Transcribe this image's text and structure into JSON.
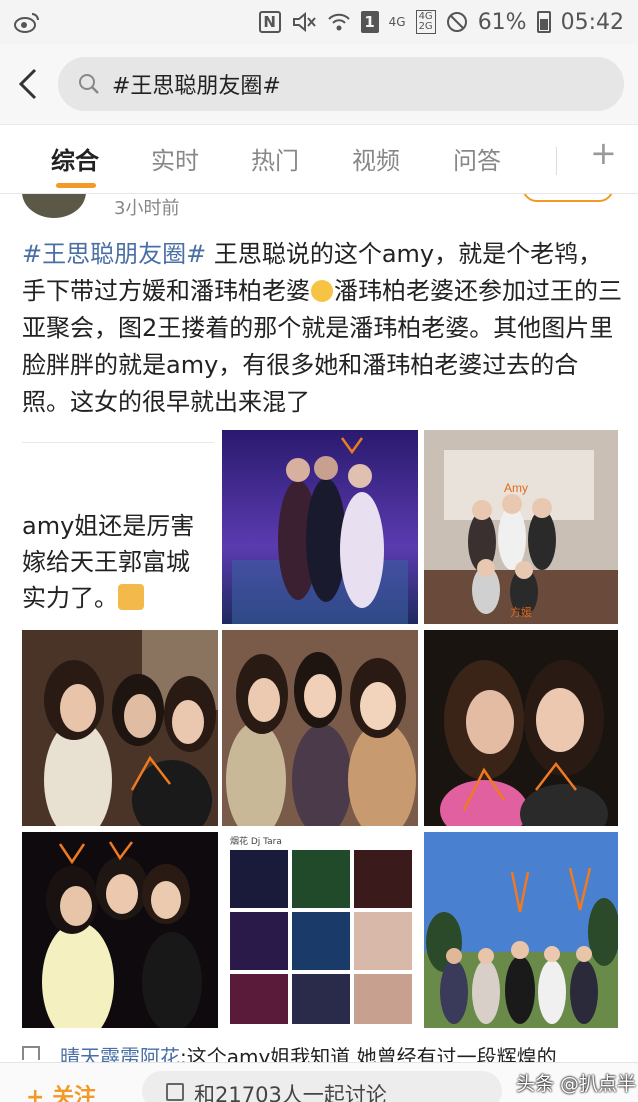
{
  "status_bar": {
    "battery": "61%",
    "time": "05:42",
    "network_1": "4G",
    "network_2a": "4G",
    "network_2b": "2G",
    "sim": "1",
    "nfc": "N"
  },
  "search": {
    "query": "#王思聪朋友圈#"
  },
  "tabs": [
    {
      "label": "综合"
    },
    {
      "label": "实时"
    },
    {
      "label": "热门"
    },
    {
      "label": "视频"
    },
    {
      "label": "问答"
    }
  ],
  "post": {
    "time": "3小时前",
    "hashtag": "#王思聪朋友圈#",
    "text_part1": " 王思聪说的这个amy，就是个老鸨，手下带过方媛和潘玮柏老婆",
    "text_part2": "潘玮柏老婆还参加过王的三亚聚会，图2王搂着的那个就是潘玮柏老婆。其他图片里脸胖胖的就是amy，有很多她和潘玮柏老婆过去的合照。这女的很早就出来混了",
    "overlay_line1": "amy姐还是厉害",
    "overlay_line2": "嫁给天王郭富城",
    "overlay_line3": "实力了。",
    "image2_label": "Amy",
    "image2_caption": "方媛",
    "image8_caption": "烟花 Dj Tara"
  },
  "comment": {
    "name": "晴天霹雳阿花",
    "text": ":这个amy姐我知道 她曾经有过一段辉煌的"
  },
  "bottom_bar": {
    "follow_label": "+ 关注",
    "discuss_label": "和21703人一起讨论",
    "watermark": "头条 @扒点半"
  },
  "colors": {
    "accent": "#f29a28",
    "hashtag": "#4a6fa5"
  }
}
